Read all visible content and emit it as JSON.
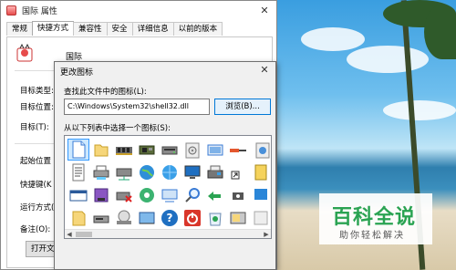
{
  "properties_window": {
    "title": "国际 属性",
    "close_glyph": "✕",
    "tabs": [
      {
        "label": "常规"
      },
      {
        "label": "快捷方式"
      },
      {
        "label": "兼容性"
      },
      {
        "label": "安全"
      },
      {
        "label": "详细信息"
      },
      {
        "label": "以前的版本"
      }
    ],
    "active_tab": "快捷方式",
    "app_name": "国际",
    "fields": {
      "target_type": "目标类型:",
      "target_location": "目标位置:",
      "target": "目标(T):",
      "start_in": "起始位置",
      "shortcut_key": "快捷键(K",
      "run": "运行方式(",
      "comment": "备注(O):"
    },
    "open_button": "打开文件"
  },
  "change_icon_dialog": {
    "title": "更改图标",
    "close_glyph": "✕",
    "find_label": "查找此文件中的图标(L):",
    "path_value": "C:\\Windows\\System32\\shell32.dll",
    "browse_label": "浏览(B)...",
    "select_label": "从以下列表中选择一个图标(S):",
    "icons": [
      [
        "blank-document-icon",
        "folder-icon",
        "memory-chip-icon",
        "hardware-chip-icon",
        "disk-drive-icon",
        "drive-cd-icon",
        "network-card-icon",
        "network-cable-icon",
        "recycle-icon"
      ],
      [
        "document-lines-icon",
        "printer-network-icon",
        "network-drive-icon",
        "globe-icon",
        "network-icon",
        "monitor-icon",
        "printer-icon",
        "shortcut-arrow-icon",
        "document-yellow-icon"
      ],
      [
        "window-icon",
        "drive-storage-icon",
        "network-disconnect-icon",
        "media-disc-icon",
        "network-search-icon",
        "search-icon",
        "recycle-network-icon",
        "camera-icon",
        "blue-panel-icon"
      ],
      [
        "folder-yellow-icon",
        "hard-disk-icon",
        "cd-drive-icon",
        "scanner-icon",
        "help-icon",
        "shutdown-icon",
        "recycle-bin-icon",
        "settings-board-icon",
        "blank-icon"
      ]
    ],
    "scroll_left": "◀",
    "scroll_right": "▶"
  },
  "watermark": {
    "title": "百科全说",
    "subtitle": "助你轻松解决"
  },
  "colors": {
    "accent": "#0078d7",
    "selection": "#cce8ff",
    "watermark_green": "#2aa352"
  }
}
